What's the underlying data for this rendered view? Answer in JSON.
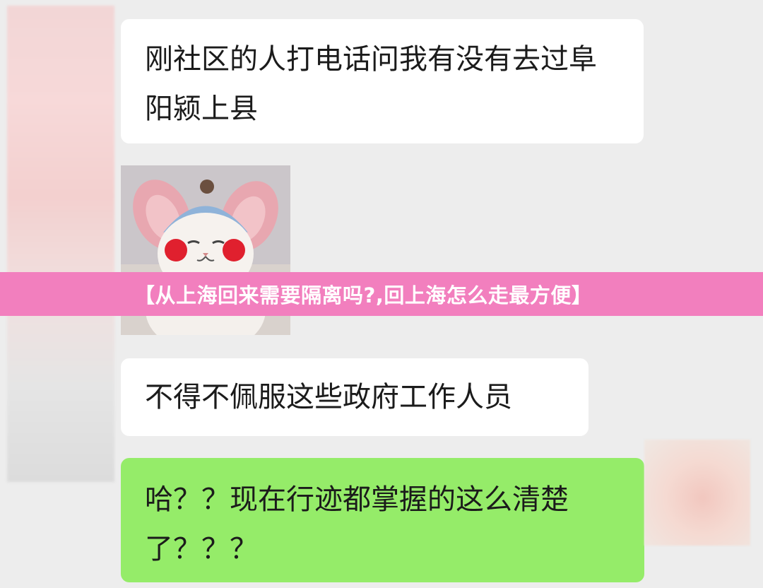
{
  "chat": {
    "messages": [
      {
        "side": "left",
        "text": "刚社区的人打电话问我有没有去过阜阳颍上县"
      },
      {
        "side": "left",
        "type": "sticker",
        "icon": "cat-sticker"
      },
      {
        "side": "left",
        "text": "不得不佩服这些政府工作人员"
      },
      {
        "side": "right",
        "text": "哈？？现在行迹都掌握的这么清楚了？？？"
      }
    ],
    "colors": {
      "left_bubble": "#ffffff",
      "right_bubble": "#95ec69",
      "background": "#ededed"
    }
  },
  "banner": {
    "text": "【从上海回来需要隔离吗?,回上海怎么走最方便】",
    "color": "#f27fbe"
  }
}
